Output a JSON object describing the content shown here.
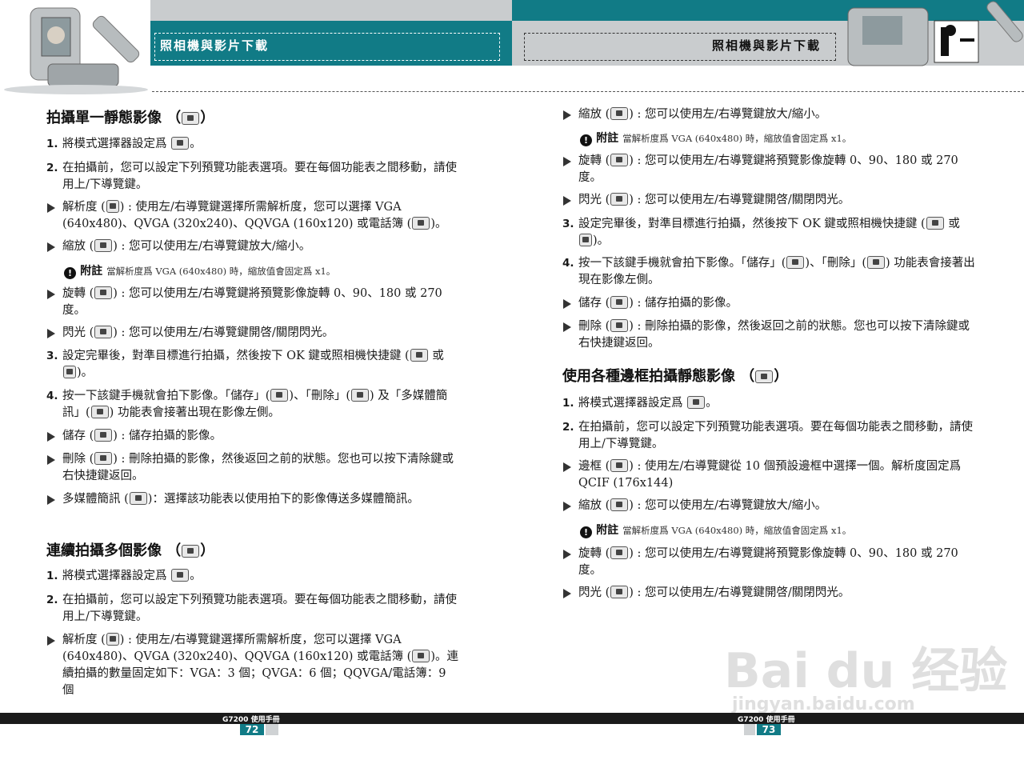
{
  "header": {
    "left_title": "照相機與影片下載",
    "right_title": "照相機與影片下載"
  },
  "left": {
    "s1": {
      "title": "拍攝單一靜態影像 （",
      "title_end": "）",
      "i1_num": "1.",
      "i1": "將模式選擇器設定爲",
      "i1_end": "。",
      "i2_num": "2.",
      "i2": "在拍攝前，您可以設定下列預覽功能表選項。要在每個功能表之間移動，請使用上/下導覽鍵。",
      "b1a": "解析度 (",
      "b1b": ") : 使用左/右導覽鍵選擇所需解析度，您可以選擇 VGA (640x480)、QVGA (320x240)、QQVGA (160x120) 或電話簿 (",
      "b1c": ")。",
      "b2a": "縮放 (",
      "b2b": ") : 您可以使用左/右導覽鍵放大/縮小。",
      "note_icon": "!",
      "note_label": "附註",
      "note_text": "當解析度爲 VGA (640x480) 時，縮放值會固定爲 x1。",
      "b3a": "旋轉 (",
      "b3b": ") : 您可以使用左/右導覽鍵將預覽影像旋轉 0、90、180 或 270 度。",
      "b4a": "閃光 (",
      "b4b": ") : 您可以使用左/右導覽鍵開啓/關閉閃光。",
      "i3_num": "3.",
      "i3a": "設定完畢後，對準目標進行拍攝，然後按下 OK 鍵或照相機快捷鍵 (",
      "i3b": "或",
      "i3c": ")。",
      "i4_num": "4.",
      "i4a": "按一下該鍵手機就會拍下影像。「儲存」(",
      "i4b": ")、「刪除」(",
      "i4c": ") 及「多媒體簡訊」(",
      "i4d": ") 功能表會接著出現在影像左側。",
      "b5a": "儲存 (",
      "b5b": ") : 儲存拍攝的影像。",
      "b6a": "刪除 (",
      "b6b": ") : 刪除拍攝的影像，然後返回之前的狀態。您也可以按下清除鍵或右快捷鍵返回。",
      "b7a": "多媒體簡訊 (",
      "b7b": ")：選擇該功能表以使用拍下的影像傳送多媒體簡訊。"
    },
    "s2": {
      "title": "連續拍攝多個影像 （",
      "title_end": "）",
      "i1_num": "1.",
      "i1": "將模式選擇器設定爲",
      "i1_end": "。",
      "i2_num": "2.",
      "i2": "在拍攝前，您可以設定下列預覽功能表選項。要在每個功能表之間移動，請使用上/下導覽鍵。",
      "b1a": "解析度 (",
      "b1b": ") : 使用左/右導覽鍵選擇所需解析度，您可以選擇 VGA (640x480)、QVGA (320x240)、QQVGA (160x120) 或電話簿 (",
      "b1c": ")。連續拍攝的數量固定如下：VGA：3 個；QVGA：6 個；QQVGA/電話簿：9 個"
    }
  },
  "right": {
    "b1a": "縮放 (",
    "b1b": ") : 您可以使用左/右導覽鍵放大/縮小。",
    "note_icon": "!",
    "note_label": "附註",
    "note_text": "當解析度爲 VGA (640x480) 時，縮放值會固定爲 x1。",
    "b2a": "旋轉 (",
    "b2b": ") : 您可以使用左/右導覽鍵將預覽影像旋轉 0、90、180 或 270 度。",
    "b3a": "閃光 (",
    "b3b": ") : 您可以使用左/右導覽鍵開啓/關閉閃光。",
    "i3_num": "3.",
    "i3a": "設定完畢後，對準目標進行拍攝，然後按下 OK 鍵或照相機快捷鍵 (",
    "i3b": "或",
    "i3c": ")。",
    "i4_num": "4.",
    "i4a": "按一下該鍵手機就會拍下影像。「儲存」(",
    "i4b": ")、「刪除」(",
    "i4c": ") 功能表會接著出現在影像左側。",
    "b4a": "儲存 (",
    "b4b": ") : 儲存拍攝的影像。",
    "b5a": "刪除 (",
    "b5b": ") : 刪除拍攝的影像，然後返回之前的狀態。您也可以按下清除鍵或右快捷鍵返回。",
    "s3": {
      "title": "使用各種邊框拍攝靜態影像 （",
      "title_end": "）",
      "i1_num": "1.",
      "i1": "將模式選擇器設定爲",
      "i1_end": "。",
      "i2_num": "2.",
      "i2": "在拍攝前，您可以設定下列預覽功能表選項。要在每個功能表之間移動，請使用上/下導覽鍵。",
      "b1a": "邊框 (",
      "b1b": ") : 使用左/右導覽鍵從 10 個預設邊框中選擇一個。解析度固定爲 QCIF (176x144)",
      "b2a": "縮放 (",
      "b2b": ") : 您可以使用左/右導覽鍵放大/縮小。",
      "note_icon": "!",
      "note_label": "附註",
      "note_text": "當解析度爲 VGA (640x480) 時，縮放值會固定爲 x1。",
      "b3a": "旋轉 (",
      "b3b": ") : 您可以使用左/右導覽鍵將預覽影像旋轉 0、90、180 或 270 度。",
      "b4a": "閃光 (",
      "b4b": ") : 您可以使用左/右導覽鍵開啓/關閉閃光。"
    }
  },
  "footer": {
    "left_manual": "G7200 使用手冊",
    "left_page": "72",
    "right_manual": "G7200 使用手冊",
    "right_page": "73"
  },
  "watermark": {
    "brand": "Bai du 经验",
    "url": "jingyan.baidu.com"
  },
  "colors": {
    "teal": "#117b86",
    "gray": "#c9ccce",
    "black": "#1b1b1b"
  }
}
